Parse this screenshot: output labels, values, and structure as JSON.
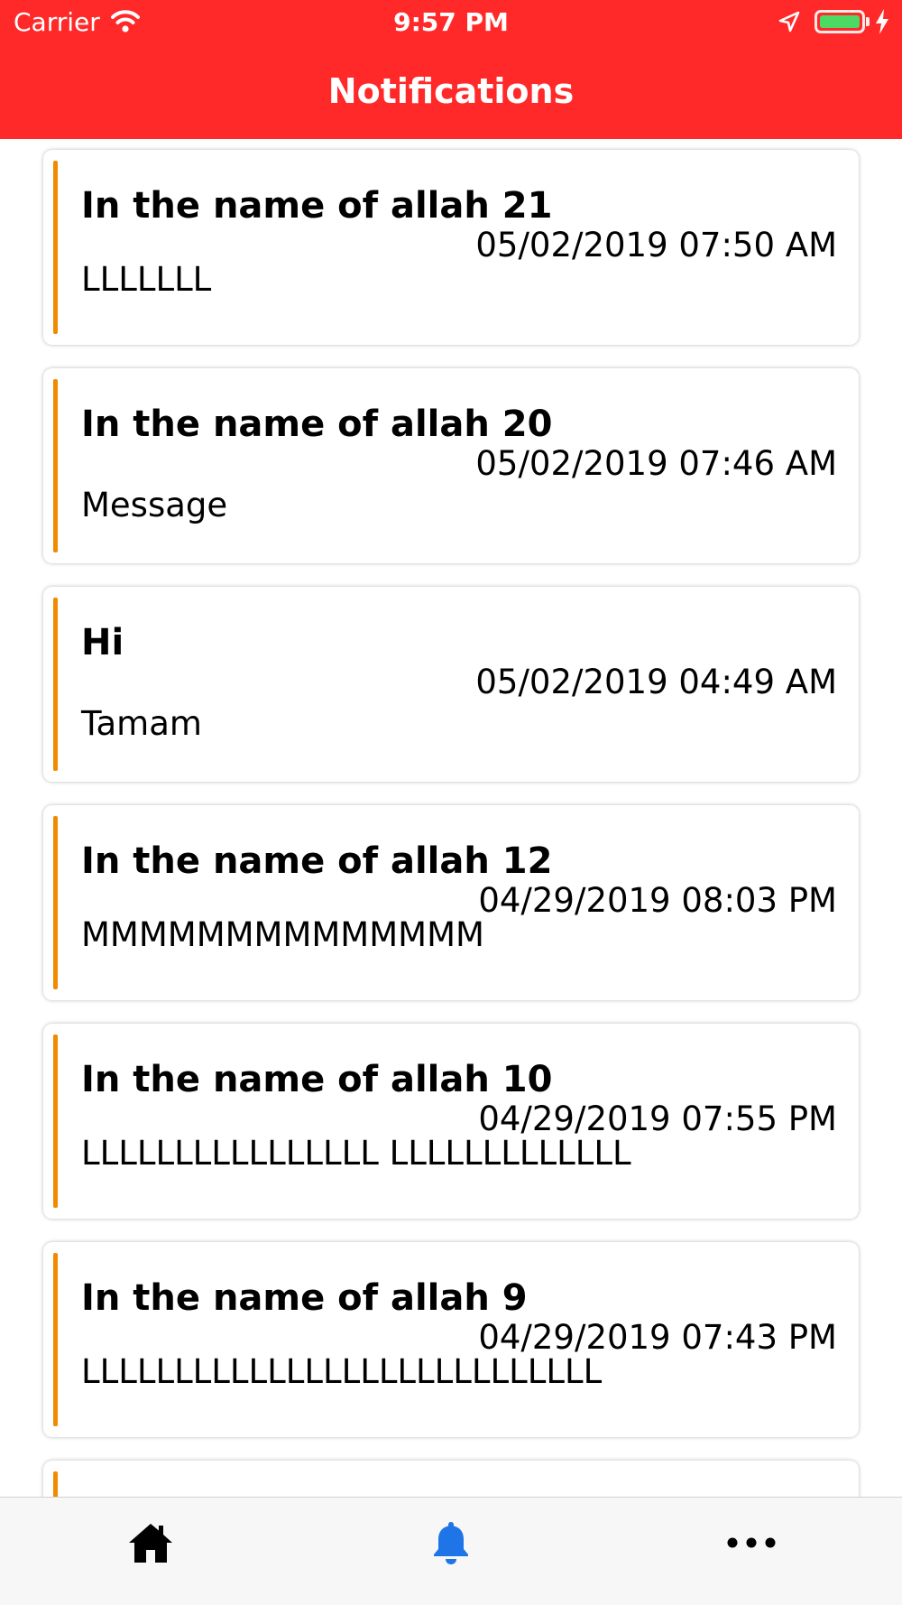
{
  "status_bar": {
    "carrier": "Carrier",
    "time": "9:57 PM",
    "battery_level": 1.0,
    "charging": true,
    "icons": [
      "wifi-icon",
      "location-arrow-icon",
      "battery-icon",
      "charging-bolt-icon"
    ]
  },
  "nav": {
    "title": "Notifications",
    "background_color": "#ff2929"
  },
  "notifications": [
    {
      "title": "In the name of allah 21",
      "date": "05/02/2019 07:50 AM",
      "message": "LLLLLLL"
    },
    {
      "title": "In the name of allah 20",
      "date": "05/02/2019 07:46 AM",
      "message": "Message"
    },
    {
      "title": "Hi",
      "date": "05/02/2019 04:49 AM",
      "message": "Tamam"
    },
    {
      "title": "In the name of allah 12",
      "date": "04/29/2019 08:03 PM",
      "message": "MMMMMMMMMMMMMM"
    },
    {
      "title": "In the name of allah 10",
      "date": "04/29/2019 07:55 PM",
      "message": "LLLLLLLLLLLLLLLL LLLLLLLLLLLLL"
    },
    {
      "title": "In the name of allah 9",
      "date": "04/29/2019 07:43 PM",
      "message": "LLLLLLLLLLLLLLLLLLLLLLLLLLLL"
    },
    {
      "title": "",
      "date": "",
      "message": ""
    }
  ],
  "card_accent_color": "#f28a00",
  "tab_bar": {
    "tabs": [
      {
        "icon": "home-icon",
        "active": false
      },
      {
        "icon": "bell-icon",
        "active": true
      },
      {
        "icon": "more-icon",
        "active": false
      }
    ],
    "active_color": "#1f74e8",
    "inactive_color": "#000000"
  }
}
